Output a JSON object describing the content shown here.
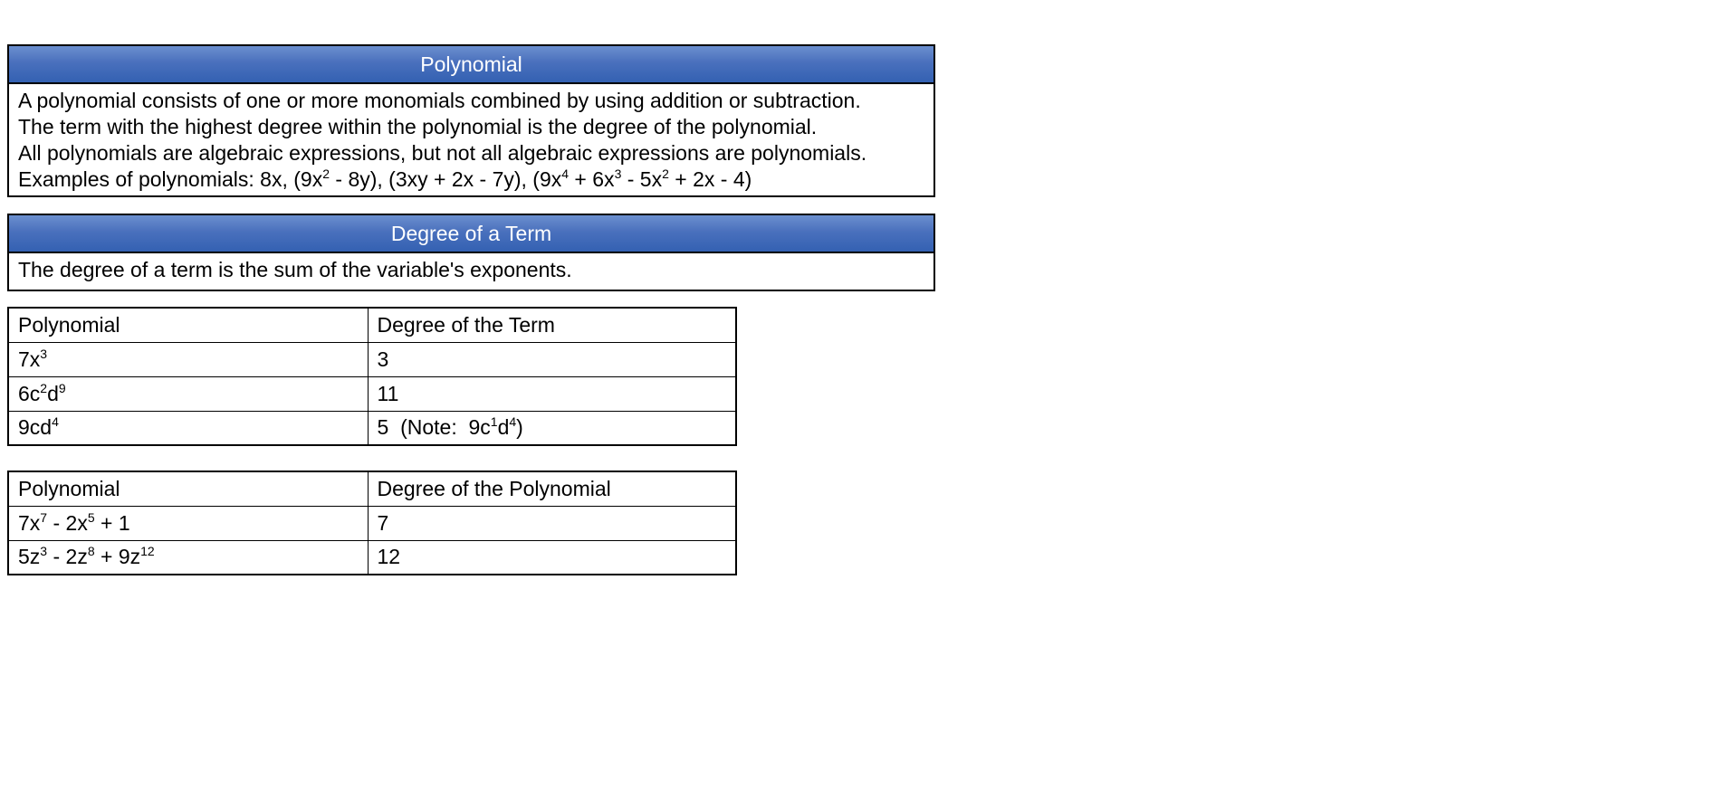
{
  "polynomial_box": {
    "title": "Polynomial",
    "line1": "A polynomial consists of one or more monomials combined by using addition or subtraction.",
    "line2": "The term with the highest degree within the polynomial is the degree of the polynomial.",
    "line3": "All polynomials are algebraic expressions, but not all algebraic expressions are polynomials.",
    "examples_label": "Examples of polynomials:  8x, (9x",
    "ex_p1_exp": "2",
    "ex_p1_rest": " - 8y), (3xy + 2x - 7y), (9x",
    "ex_p2_exp": "4",
    "ex_p2_rest": " + 6x",
    "ex_p3_exp": "3",
    "ex_p3_rest": " - 5x",
    "ex_p4_exp": "2",
    "ex_p4_rest": " + 2x - 4)"
  },
  "degree_box": {
    "title": "Degree of a Term",
    "text": "The degree of a term is the sum of the variable's exponents."
  },
  "term_table": {
    "header_col1": "Polynomial",
    "header_col2": "Degree of the Term",
    "rows": [
      {
        "base": "7x",
        "exp": "3",
        "degree": "3"
      },
      {
        "a": "6c",
        "a_exp": "2",
        "b": "d",
        "b_exp": "9",
        "degree": "11"
      },
      {
        "base": "9cd",
        "exp": "4",
        "degree_a": "5  (Note:  9c",
        "degree_exp1": "1",
        "degree_b": "d",
        "degree_exp2": "4",
        "degree_c": ")"
      }
    ]
  },
  "poly_table": {
    "header_col1": "Polynomial",
    "header_col2": "Degree of the Polynomial",
    "rows": [
      {
        "t1": "7x",
        "e1": "7",
        "t2": " - 2x",
        "e2": "5",
        "t3": " + 1",
        "degree": "7"
      },
      {
        "t1": "5z",
        "e1": "3",
        "t2": " - 2z",
        "e2": "8",
        "t3": " + 9z",
        "e3": "12",
        "degree": "12"
      }
    ]
  }
}
